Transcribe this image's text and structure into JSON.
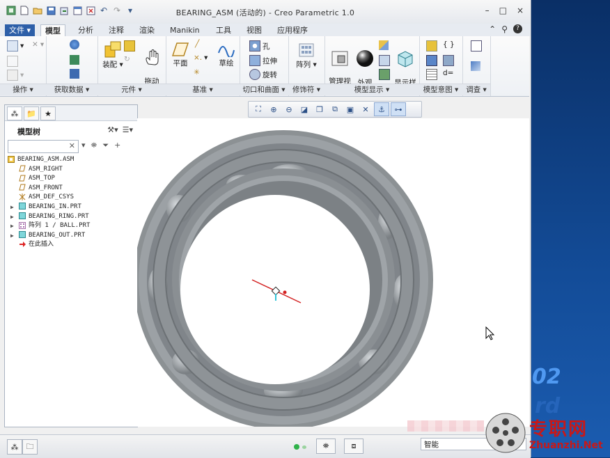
{
  "window": {
    "title": "BEARING_ASM (活动的) - Creo Parametric 1.0",
    "controls": [
      "–",
      "□",
      "×"
    ]
  },
  "ribbon_tabs": [
    "文件",
    "模型",
    "分析",
    "注释",
    "渲染",
    "Manikin",
    "工具",
    "视图",
    "应用程序"
  ],
  "active_tab": "模型",
  "groups": {
    "caozuo": "操作",
    "huoqu": "获取数据",
    "yuanjian": "元件",
    "jizhun": "基准",
    "qiekou": "切口和曲面",
    "xiushifu": "修饰符",
    "moxingxianshi": "模型显示",
    "moxingyitu": "模型意图",
    "diaocha": "调查"
  },
  "buttons": {
    "zhuangpei": "装配",
    "tuodong": "拖动\n元件",
    "pingmian": "平面",
    "caohui": "草绘",
    "kong": "孔",
    "lashen": "拉伸",
    "xuanzhuan": "旋转",
    "zhenlie": "阵列",
    "guanli": "管理视\n图",
    "waiguan": "外观\n库",
    "xianshiyang": "显示样\n式",
    "d_eq": "d="
  },
  "model_tree": {
    "title": "模型树",
    "search_placeholder": "",
    "items": [
      {
        "label": "BEARING_ASM.ASM",
        "level": 0,
        "icon": "assembly-icon",
        "expander": ""
      },
      {
        "label": "ASM_RIGHT",
        "level": 1,
        "icon": "datum-plane-icon",
        "expander": ""
      },
      {
        "label": "ASM_TOP",
        "level": 1,
        "icon": "datum-plane-icon",
        "expander": ""
      },
      {
        "label": "ASM_FRONT",
        "level": 1,
        "icon": "datum-plane-icon",
        "expander": ""
      },
      {
        "label": "ASM_DEF_CSYS",
        "level": 1,
        "icon": "csys-icon",
        "expander": ""
      },
      {
        "label": "BEARING_IN.PRT",
        "level": 1,
        "icon": "part-icon",
        "expander": "▶"
      },
      {
        "label": "BEARING_RING.PRT",
        "level": 1,
        "icon": "part-icon",
        "expander": "▶"
      },
      {
        "label": "阵列 1 / BALL.PRT",
        "level": 1,
        "icon": "pattern-icon",
        "expander": "▶"
      },
      {
        "label": "BEARING_OUT.PRT",
        "level": 1,
        "icon": "part-icon",
        "expander": "▶"
      },
      {
        "label": "在此插入",
        "level": 1,
        "icon": "insert-arrow-icon",
        "expander": ""
      }
    ]
  },
  "status": {
    "filter": "智能"
  },
  "watermark": {
    "text": "专职网",
    "url": "Zhuanzhi.Net"
  },
  "desktop": {
    "partial_number": "02",
    "partial_letters": "rd"
  },
  "colors": {
    "file_tab": "#2d5fa8",
    "bearing": "#8c9194",
    "axis_red": "#d32020",
    "watermark": "#c81818"
  }
}
